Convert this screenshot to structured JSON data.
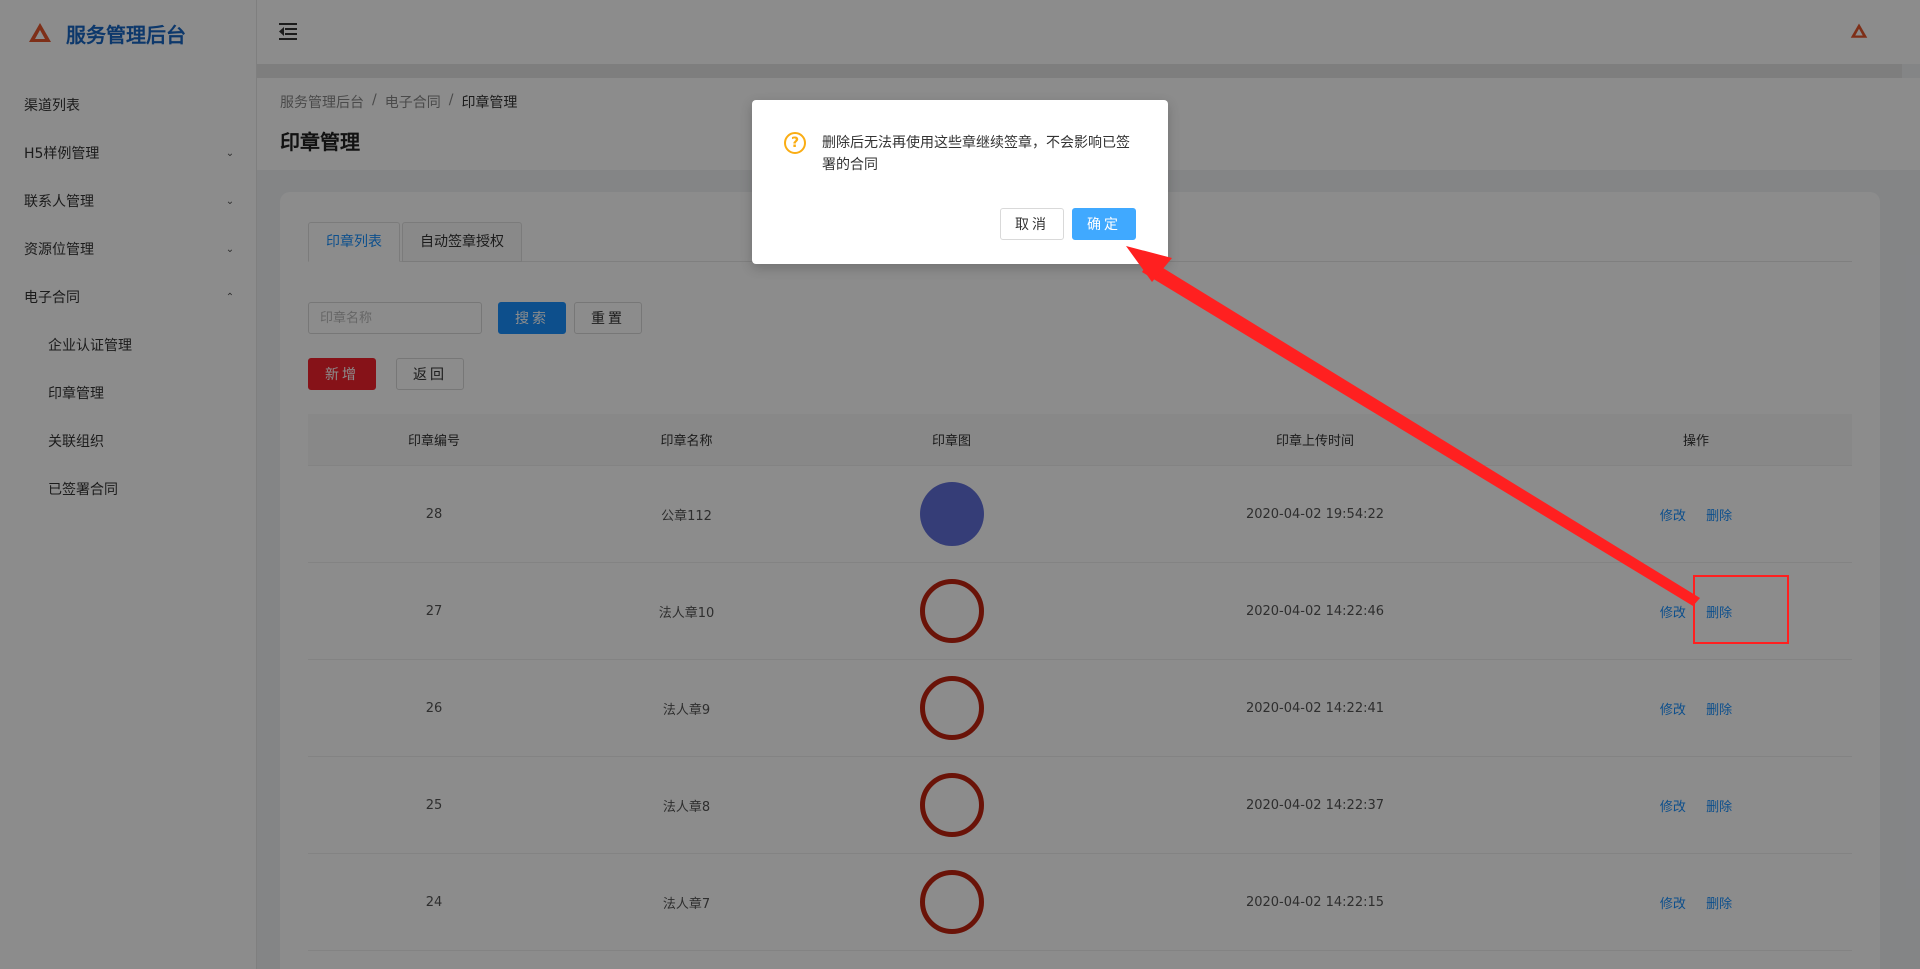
{
  "app": {
    "title": "服务管理后台"
  },
  "sidebar": {
    "items": [
      {
        "label": "渠道列表",
        "chevron": ""
      },
      {
        "label": "H5样例管理",
        "chevron": "⌄"
      },
      {
        "label": "联系人管理",
        "chevron": "⌄"
      },
      {
        "label": "资源位管理",
        "chevron": "⌄"
      },
      {
        "label": "电子合同",
        "chevron": "⌃"
      }
    ],
    "subitems": [
      {
        "label": "企业认证管理"
      },
      {
        "label": "印章管理"
      },
      {
        "label": "关联组织"
      },
      {
        "label": "已签署合同"
      }
    ]
  },
  "breadcrumb": [
    "服务管理后台",
    "/",
    "电子合同",
    "/",
    "印章管理"
  ],
  "page_title": "印章管理",
  "tabs": [
    {
      "label": "印章列表",
      "active": true
    },
    {
      "label": "自动签章授权",
      "active": false
    }
  ],
  "search": {
    "placeholder": "印章名称",
    "search_label": "搜索",
    "reset_label": "重置"
  },
  "actions": {
    "add_label": "新增",
    "back_label": "返回"
  },
  "table": {
    "headers": [
      "印章编号",
      "印章名称",
      "印章图",
      "印章上传时间",
      "操作"
    ],
    "rows": [
      {
        "id": "28",
        "name": "公章112",
        "seal": "filled",
        "time": "2020-04-02 19:54:22",
        "edit": "修改",
        "delete": "删除"
      },
      {
        "id": "27",
        "name": "法人章10",
        "seal": "ring",
        "time": "2020-04-02 14:22:46",
        "edit": "修改",
        "delete": "删除"
      },
      {
        "id": "26",
        "name": "法人章9",
        "seal": "ring",
        "time": "2020-04-02 14:22:41",
        "edit": "修改",
        "delete": "删除"
      },
      {
        "id": "25",
        "name": "法人章8",
        "seal": "ring",
        "time": "2020-04-02 14:22:37",
        "edit": "修改",
        "delete": "删除"
      },
      {
        "id": "24",
        "name": "法人章7",
        "seal": "ring",
        "time": "2020-04-02 14:22:15",
        "edit": "修改",
        "delete": "删除"
      }
    ]
  },
  "modal": {
    "icon": "?",
    "message": "删除后无法再使用这些章继续签章，不会影响已签署的合同",
    "cancel_label": "取消",
    "ok_label": "确定"
  },
  "colors": {
    "primary": "#1890ff",
    "danger": "#f5222d",
    "warning": "#faad14",
    "brand": "#1967c4",
    "annotation": "#ff2020"
  }
}
